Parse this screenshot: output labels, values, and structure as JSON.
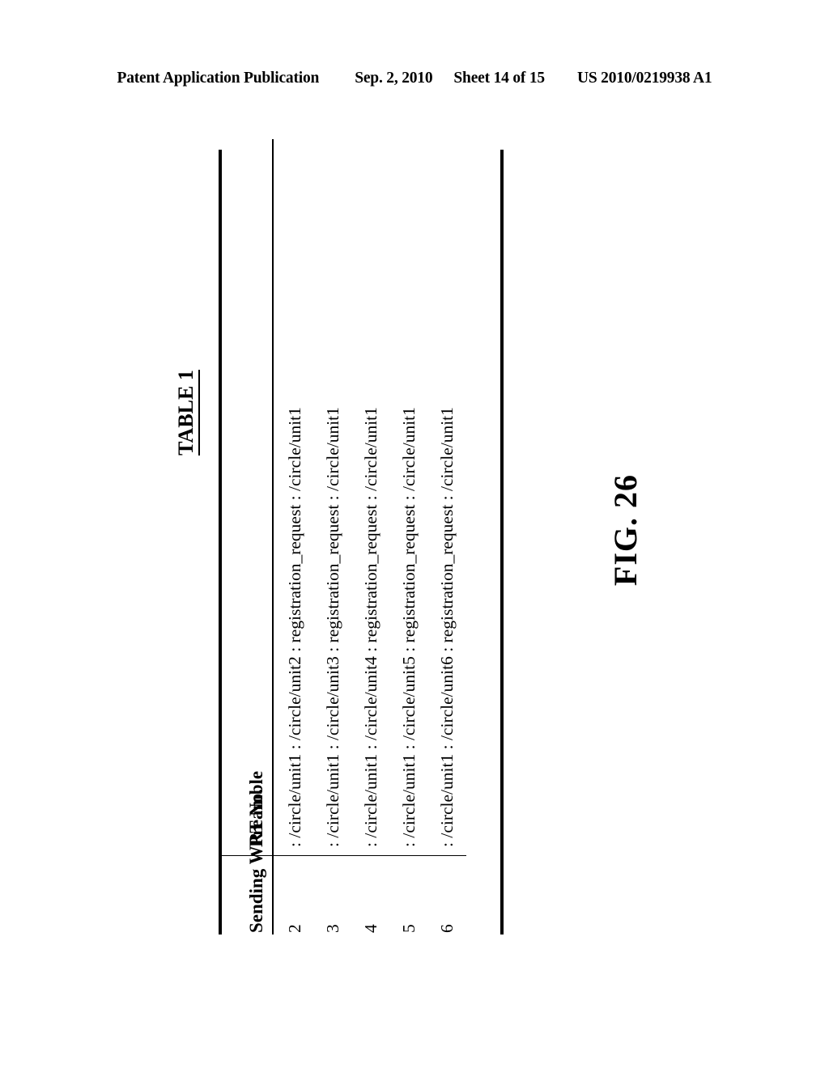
{
  "page_header": {
    "publication": "Patent Application Publication",
    "date": "Sep. 2, 2010",
    "sheet": "Sheet 14 of 15",
    "patent_number": "US 2010/0219938 A1"
  },
  "figure": {
    "caption": "TABLE 1",
    "label": "FIG. 26"
  },
  "table": {
    "columns": [
      {
        "key": "no",
        "header": "Sending WRT No."
      },
      {
        "key": "preamble",
        "header": "Preamble"
      }
    ],
    "rows": [
      {
        "no": "2",
        "preamble": ": /circle/unit1 : /circle/unit2 : registration_request : /circle/unit1"
      },
      {
        "no": "3",
        "preamble": ": /circle/unit1 : /circle/unit3 : registration_request : /circle/unit1"
      },
      {
        "no": "4",
        "preamble": ": /circle/unit1 : /circle/unit4 : registration_request : /circle/unit1"
      },
      {
        "no": "5",
        "preamble": ": /circle/unit1 : /circle/unit5 : registration_request : /circle/unit1"
      },
      {
        "no": "6",
        "preamble": ": /circle/unit1 : /circle/unit6 : registration_request : /circle/unit1"
      }
    ]
  },
  "colors": {
    "ink": "#000000",
    "paper": "#ffffff"
  }
}
